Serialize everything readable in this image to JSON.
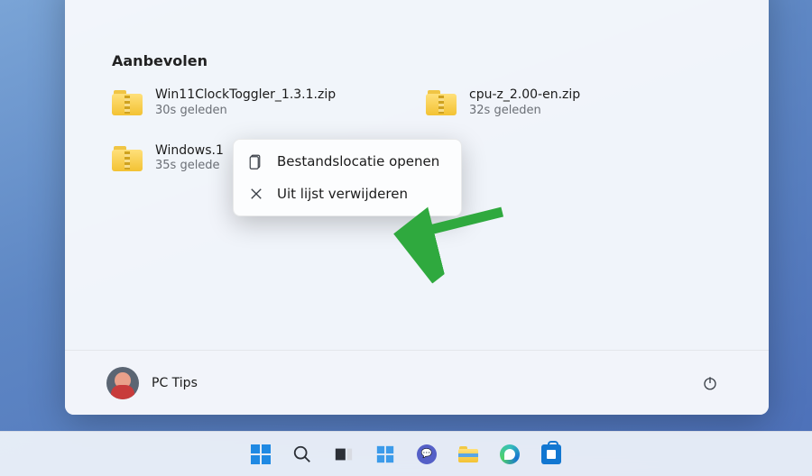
{
  "section_title": "Aanbevolen",
  "items": [
    {
      "name": "Win11ClockToggler_1.3.1.zip",
      "time": "30s geleden"
    },
    {
      "name": "cpu-z_2.00-en.zip",
      "time": "32s geleden"
    },
    {
      "name": "Windows.1",
      "time": "35s gelede"
    }
  ],
  "user": {
    "name": "PC Tips"
  },
  "context_menu": {
    "open_location": "Bestandslocatie openen",
    "remove": "Uit lijst verwijderen"
  },
  "arrow_color": "#2fa93e",
  "taskbar_icons": [
    "start",
    "search",
    "taskview",
    "widgets",
    "chat",
    "explorer",
    "edge",
    "store"
  ]
}
